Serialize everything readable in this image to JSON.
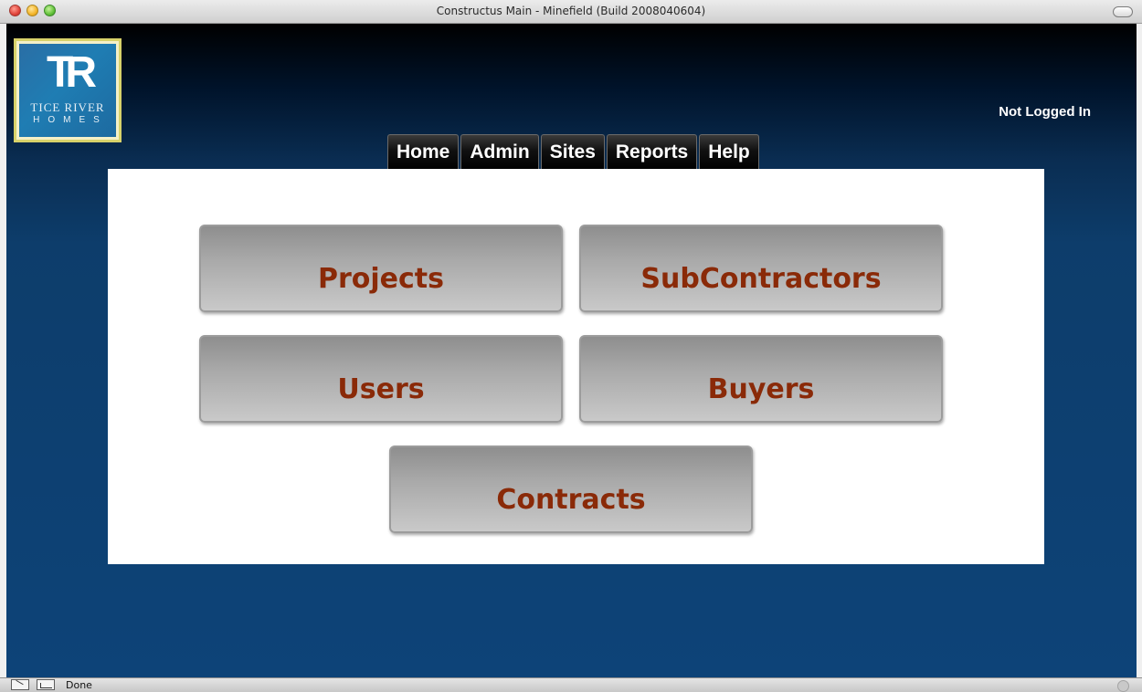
{
  "window": {
    "title": "Constructus Main - Minefield (Build 2008040604)"
  },
  "logo": {
    "mark": "TR",
    "line1": "TICE RIVER",
    "line2": "HOMES",
    "colors": {
      "frame": "#d8d26a",
      "background": "#1f7db3"
    }
  },
  "header": {
    "login_status": "Not Logged In"
  },
  "tabs": [
    {
      "label": "Home"
    },
    {
      "label": "Admin"
    },
    {
      "label": "Sites"
    },
    {
      "label": "Reports"
    },
    {
      "label": "Help"
    }
  ],
  "main": {
    "buttons": [
      {
        "label": "Projects"
      },
      {
        "label": "SubContractors"
      },
      {
        "label": "Users"
      },
      {
        "label": "Buyers"
      },
      {
        "label": "Contracts"
      }
    ],
    "colors": {
      "button_text": "#8a2a08",
      "page_background": "#0d4378"
    }
  },
  "statusbar": {
    "text": "Done"
  }
}
